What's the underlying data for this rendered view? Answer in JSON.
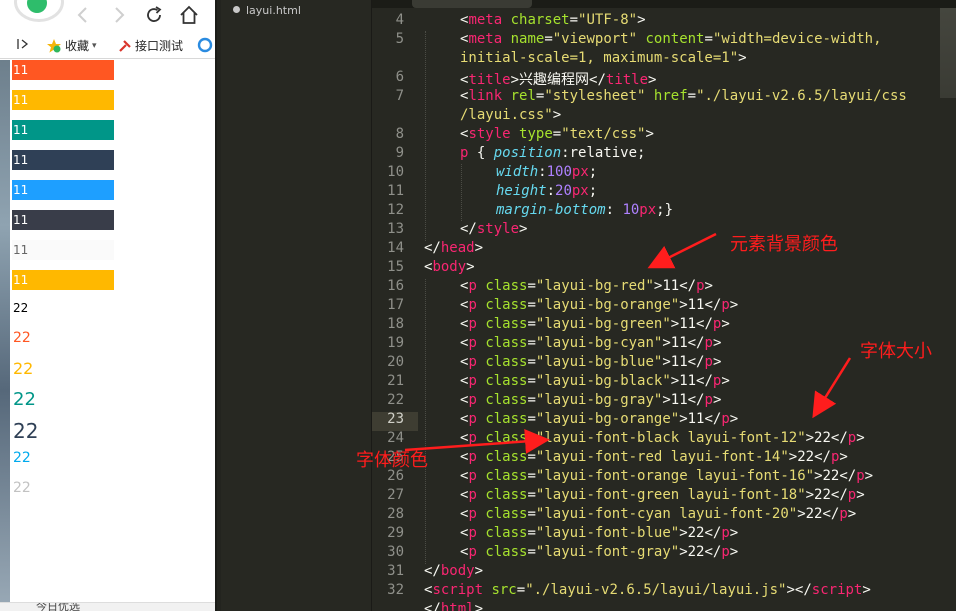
{
  "browser": {
    "bookmarks": [
      {
        "label": "收藏",
        "icon": "star-icon"
      },
      {
        "label": "接口测试",
        "icon": "tool-icon"
      }
    ],
    "status_text": "今日优选",
    "bg_items": [
      {
        "text": "11",
        "color": "#FF5722"
      },
      {
        "text": "11",
        "color": "#FFB800"
      },
      {
        "text": "11",
        "color": "#009688"
      },
      {
        "text": "11",
        "color": "#2F4056"
      },
      {
        "text": "11",
        "color": "#1E9FFF"
      },
      {
        "text": "11",
        "color": "#393D49"
      },
      {
        "text": "11",
        "color": "#FAFAFA"
      },
      {
        "text": "11",
        "color": "#FFB800"
      }
    ],
    "font_items": [
      {
        "text": "22",
        "color": "#000000"
      },
      {
        "text": "22",
        "color": "#FF5722"
      },
      {
        "text": "22",
        "color": "#FFB800"
      },
      {
        "text": "22",
        "color": "#009688"
      },
      {
        "text": "22",
        "color": "#2F4056"
      },
      {
        "text": "22",
        "color": "#01AAED"
      },
      {
        "text": "22",
        "color": "#C2C2C2"
      }
    ]
  },
  "sidebar": {
    "file_name": "layui.html"
  },
  "editor": {
    "line_numbers": [
      "4",
      "5",
      "",
      "6",
      "7",
      "",
      "8",
      "9",
      "10",
      "11",
      "12",
      "13",
      "14",
      "15",
      "16",
      "17",
      "18",
      "19",
      "20",
      "21",
      "22",
      "23",
      "24",
      "25",
      "26",
      "27",
      "28",
      "29",
      "30",
      "31",
      "32"
    ],
    "current_line": "23"
  },
  "annotations": {
    "bg_color": "元素背景颜色",
    "font_size": "字体大小",
    "font_color": "字体颜色"
  },
  "colors": {
    "editor_bg": "#272822",
    "tag": "#F92672",
    "attribute": "#A6E22E",
    "string": "#E6DB74",
    "property": "#66D9EF",
    "number": "#AE81FF",
    "annotation": "#FF1D1D"
  }
}
